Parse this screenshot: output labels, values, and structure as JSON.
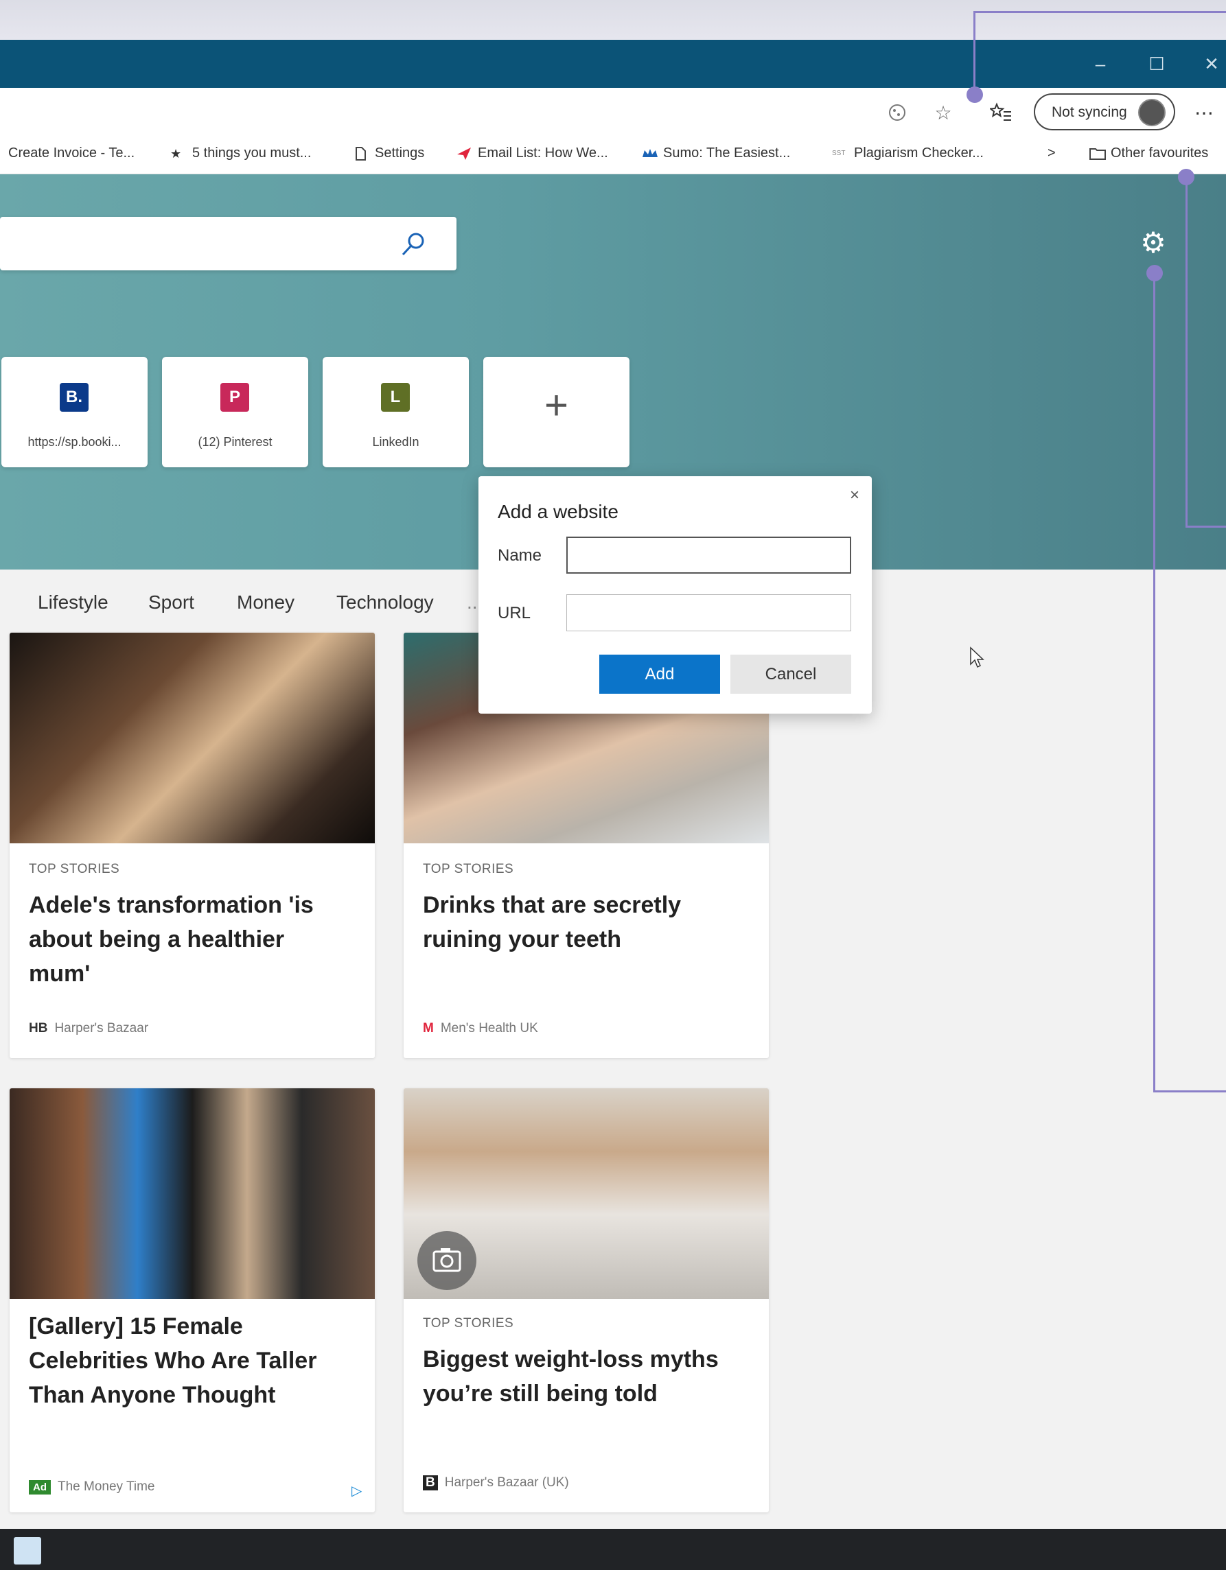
{
  "toolbar": {
    "sync_label": "Not syncing",
    "more_label": "⋯"
  },
  "favorites": [
    {
      "label": "Create Invoice - Te...",
      "icon": "invoice-icon"
    },
    {
      "label": "5 things you must...",
      "icon": "star-icon"
    },
    {
      "label": "Settings",
      "icon": "page-icon"
    },
    {
      "label": "Email List: How We...",
      "icon": "email-list-icon"
    },
    {
      "label": "Sumo: The Easiest...",
      "icon": "crown-icon"
    },
    {
      "label": "Plagiarism Checker...",
      "icon": "sst-icon"
    }
  ],
  "favorites_more": ">",
  "other_favourites": "Other favourites",
  "tiles": [
    {
      "badge": "B.",
      "label": "https://sp.booki...",
      "color": "#0b3a8a"
    },
    {
      "badge": "P",
      "label": "(12) Pinterest",
      "color": "#c8285a"
    },
    {
      "badge": "L",
      "label": "LinkedIn",
      "color": "#5f6f25"
    },
    {
      "badge": "+",
      "label": "",
      "color": ""
    }
  ],
  "categories": [
    "Lifestyle",
    "Sport",
    "Money",
    "Technology",
    "..."
  ],
  "dialog": {
    "title": "Add a website",
    "close": "×",
    "name_label": "Name",
    "url_label": "URL",
    "name_value": "",
    "url_value": "",
    "add_label": "Add",
    "cancel_label": "Cancel"
  },
  "cards": [
    {
      "tag": "TOP STORIES",
      "title": "Adele's transformation 'is about being a healthier mum'",
      "source_logo": "HB",
      "source": "Harper's Bazaar"
    },
    {
      "tag": "TOP STORIES",
      "title": "Drinks that are secretly ruining your teeth",
      "source_logo": "M",
      "source": "Men's Health UK"
    },
    {
      "tag": "",
      "title": "[Gallery] 15 Female Celebrities Who Are Taller Than Anyone Thought",
      "source_logo": "Ad",
      "source": "The Money Time"
    },
    {
      "tag": "TOP STORIES",
      "title": "Biggest weight-loss myths you’re still being told",
      "source_logo": "B",
      "source": "Harper's Bazaar (UK)"
    }
  ],
  "colors": {
    "titlebar": "#0b5377",
    "accent": "#0b74c9",
    "callout": "#8a7fc8",
    "hero": "#5f9da3"
  }
}
